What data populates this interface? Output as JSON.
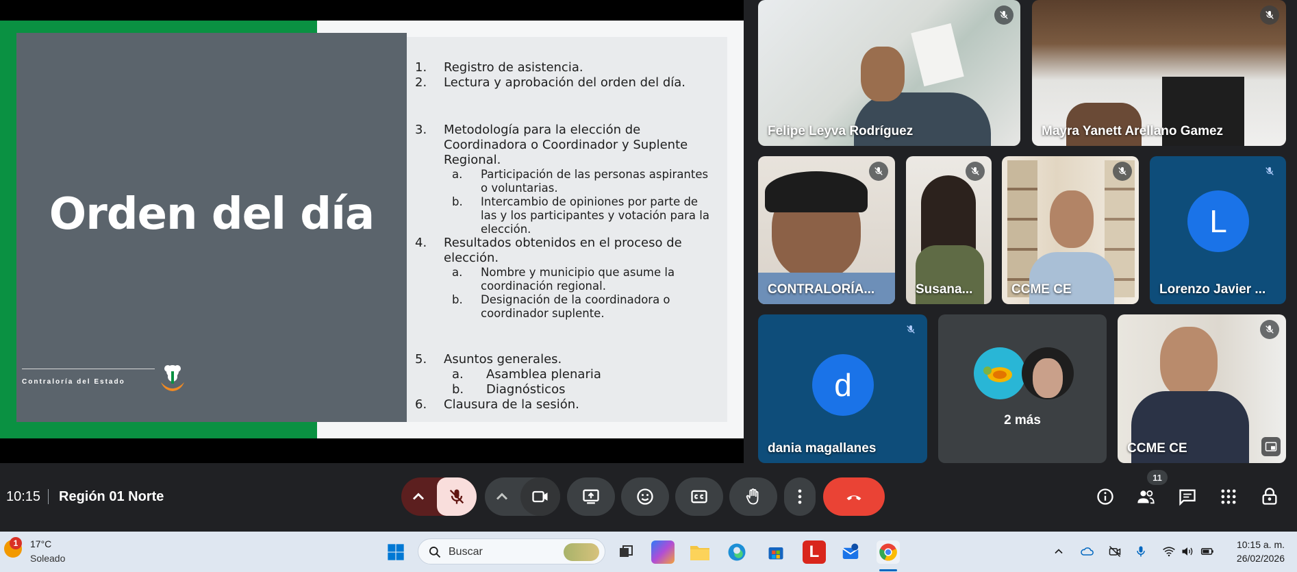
{
  "meeting": {
    "time": "10:15",
    "title": "Región 01 Norte",
    "participant_count_badge": "11"
  },
  "slide": {
    "title": "Orden del día",
    "organization": "Contraloría del Estado",
    "agenda": [
      {
        "num": "1.",
        "text": "Registro de asistencia."
      },
      {
        "num": "2.",
        "text": "Lectura y aprobación del orden del día."
      },
      {
        "num": "3.",
        "lines": [
          "Metodología para la elección de",
          "Coordinadora o Coordinador y Suplente",
          "Regional."
        ],
        "subs": [
          {
            "num": "a.",
            "lines": [
              "Participación de las personas aspirantes",
              "o voluntarias."
            ]
          },
          {
            "num": "b.",
            "lines": [
              "Intercambio de opiniones por parte de",
              "las y los participantes y votación para la",
              "elección."
            ]
          }
        ]
      },
      {
        "num": "4.",
        "lines": [
          "Resultados obtenidos en el proceso de",
          "elección."
        ],
        "subs": [
          {
            "num": "a.",
            "lines": [
              "Nombre y municipio que asume la",
              "coordinación regional."
            ]
          },
          {
            "num": "b.",
            "lines": [
              "Designación de la coordinadora o",
              "coordinador suplente."
            ]
          }
        ]
      },
      {
        "num": "5.",
        "text": "Asuntos generales.",
        "subs": [
          {
            "num": "a.",
            "text": "Asamblea plenaria"
          },
          {
            "num": "b.",
            "text": "Diagnósticos"
          }
        ]
      },
      {
        "num": "6.",
        "text": "Clausura de la sesión."
      }
    ]
  },
  "participants": [
    {
      "name": "Felipe Leyva Rodríguez"
    },
    {
      "name": "Mayra Yanett Arellano Gamez"
    },
    {
      "name": "CONTRALORÍA..."
    },
    {
      "name": "Susana..."
    },
    {
      "name": "CCME CE"
    },
    {
      "name": "Lorenzo Javier ...",
      "initial": "L"
    },
    {
      "name": "dania magallanes",
      "initial": "d"
    },
    {
      "name": "2 más"
    },
    {
      "name": "CCME CE"
    }
  ],
  "taskbar": {
    "weather_badge": "1",
    "temperature": "17°C",
    "condition": "Soleado",
    "search_placeholder": "Buscar",
    "clock_time": "10:15 a. m.",
    "clock_date": "26/02/2026"
  },
  "colors": {
    "meet_bg": "#202124",
    "slide_green": "#0a9142",
    "slide_gray": "#5b646c",
    "end_call_red": "#ea4335",
    "mic_off_bg": "#f9dedc",
    "avatar_blue": "#1a73e8"
  }
}
